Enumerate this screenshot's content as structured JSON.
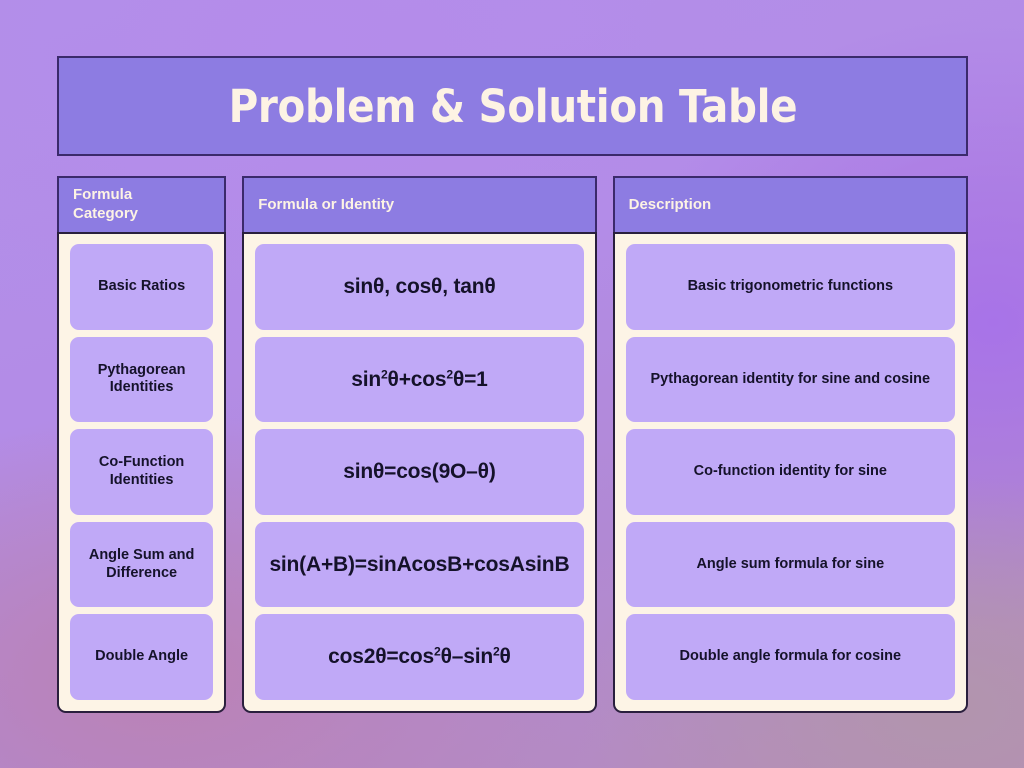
{
  "header": {
    "title": "Problem & Solution Table",
    "bar_color": "#8d7ce2",
    "border_color": "#3b2a6b",
    "text_color": "#fdf3e4"
  },
  "theme": {
    "card_background": "#fdf4e6",
    "cell_background": "#c0a9f7",
    "cell_text_color": "#15122a",
    "page_background": "#b08ae6"
  },
  "table": {
    "columns": [
      {
        "id": "category",
        "header": "Formula\nCategory"
      },
      {
        "id": "formula",
        "header": "Formula or Identity"
      },
      {
        "id": "description",
        "header": "Description"
      }
    ],
    "rows": [
      {
        "category": "Basic Ratios",
        "formula_plain": "sinθ, cosθ, tanθ",
        "formula_html": "sin&#952;, cos&#952;, tan&#952;",
        "description": "Basic trigonometric functions"
      },
      {
        "category": "Pythagorean\nIdentities",
        "formula_plain": "sin²θ+cos²θ=1",
        "formula_html": "sin<sup>2</sup>&#952;+cos<sup>2</sup>&#952;=1",
        "description": "Pythagorean identity for sine and cosine"
      },
      {
        "category": "Co-Function\nIdentities",
        "formula_plain": "sinθ=cos(9O–θ)",
        "formula_html": "sin&#952;=cos(9O&#8211;&#952;)",
        "description": "Co-function identity for sine"
      },
      {
        "category": "Angle Sum and\nDifference",
        "formula_plain": "sin(A+B)=sinAcosB+cosAsinB",
        "formula_html": "sin(A+B)=sinAcosB+cosAsinB",
        "description": "Angle sum formula for sine"
      },
      {
        "category": "Double Angle",
        "formula_plain": "cos2θ=cos²θ–sin²θ",
        "formula_html": "cos2&#952;=cos<sup>2</sup>&#952;&#8211;sin<sup>2</sup>&#952;",
        "description": "Double angle formula for cosine"
      }
    ]
  }
}
